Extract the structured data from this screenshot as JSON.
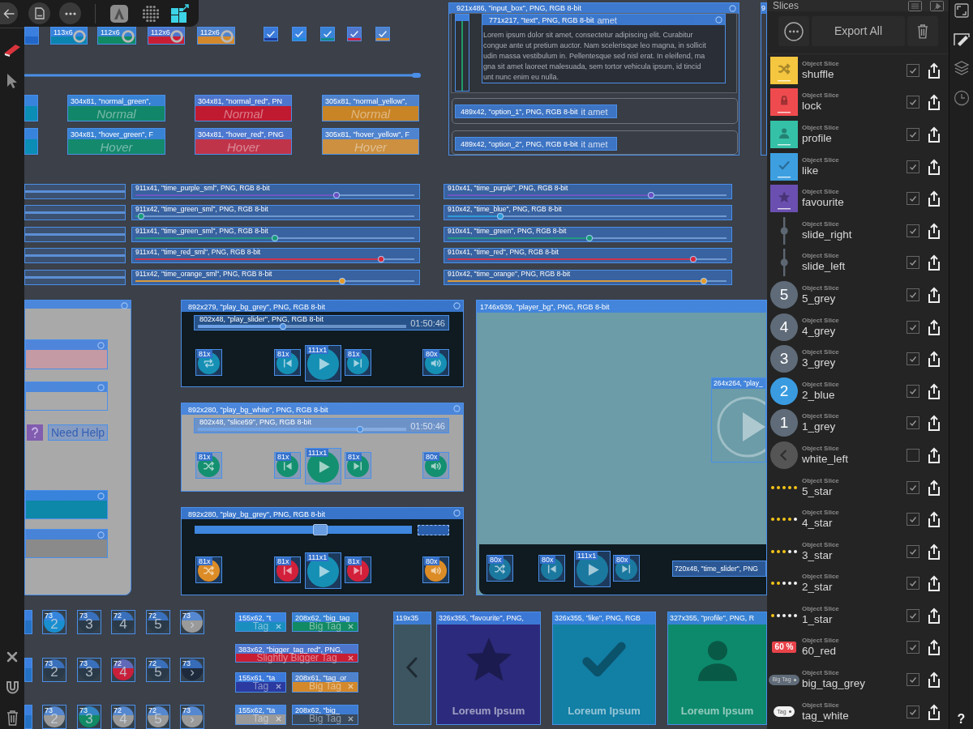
{
  "toolbar": {
    "personas": [
      {
        "kind": "designer",
        "selected": false
      },
      {
        "kind": "pixel",
        "selected": false
      },
      {
        "kind": "export",
        "selected": true
      }
    ]
  },
  "canvas": {
    "toggles": [
      {
        "color": "#2266c8"
      },
      {
        "label": "113x6",
        "color": "#0c84b0"
      },
      {
        "label": "112x6",
        "color": "#118a64"
      },
      {
        "label": "112x6",
        "color": "#c81e34"
      },
      {
        "label": "112x6",
        "color": "#d3892b"
      }
    ],
    "checkboxes": [
      {
        "color": "#1c3b9c",
        "checked": true
      },
      {
        "color": "#1e8ad8",
        "checked": true
      },
      {
        "color": "#128a8a",
        "checked": true
      },
      {
        "color": "#d3203a",
        "checked": true
      },
      {
        "color": "#d3892b",
        "checked": true
      }
    ],
    "button_rows": [
      {
        "items": [
          {
            "color": "#0b8db5"
          },
          {
            "label": "304x81, \"normal_green\",",
            "text": "Normal",
            "color": "#128669"
          },
          {
            "label": "304x81, \"normal_red\", PN",
            "text": "Normal",
            "color": "#c01a31"
          },
          {
            "label": "305x81, \"normal_yellow\",",
            "text": "Normal",
            "color": "#c98426"
          }
        ]
      },
      {
        "items": [
          {
            "color": "#0b8db5"
          },
          {
            "label": "304x81, \"hover_green\", F",
            "text": "Hover",
            "color": "#14896c"
          },
          {
            "label": "304x81, \"hover_red\", PNG",
            "text": "Hover",
            "color": "#c0344a"
          },
          {
            "label": "305x81, \"hover_yellow\", F",
            "text": "Hover",
            "color": "#cc9040"
          }
        ]
      }
    ],
    "slider_columns": [
      {
        "items": [
          {
            "label": "911x41, \"time_purple_sml\", PNG, RGB 8-bit",
            "level": 0.72,
            "color": "#6b4fc0"
          },
          {
            "label": "911x42, \"time_green_sml\", PNG, RGB 8-bit",
            "level": 0.02,
            "color": "#1a9a78"
          },
          {
            "label": "911x41, \"time_green_sml\", PNG, RGB 8-bit",
            "level": 0.5,
            "color": "#1a9a78"
          },
          {
            "label": "911x41, \"time_red_sml\", PNG, RGB 8-bit",
            "level": 0.88,
            "color": "#d8283c"
          },
          {
            "label": "911x42, \"time_orange_sml\", PNG, RGB 8-bit",
            "level": 0.74,
            "color": "#e49a2a"
          }
        ]
      },
      {
        "items": [
          {
            "label": "910x41, \"time_purple\", PNG, RGB 8-bit",
            "level": 0.73,
            "color": "#6b4fc0"
          },
          {
            "label": "910x42, \"time_blue\", PNG, RGB 8-bit",
            "level": 0.19,
            "color": "#2a9bd8"
          },
          {
            "label": "910x41, \"time_green\", PNG, RGB 8-bit",
            "level": 0.51,
            "color": "#1a9a78"
          },
          {
            "label": "910x41, \"time_red\", PNG, RGB 8-bit",
            "level": 0.88,
            "color": "#d8283c"
          },
          {
            "label": "910x42, \"time_orange\", PNG, RGB 8-bit",
            "level": 0.92,
            "color": "#e49a2a"
          }
        ]
      }
    ],
    "input_box": {
      "label": "921x486, \"input_box\", PNG, RGB 8-bit",
      "text_slice": {
        "label": "771x217, \"text\", PNG, RGB 8-bit",
        "faded_text": "amet",
        "lines": [
          "Lorem ipsum dolor sit amet, consectetur adipiscing elit. Curabitur",
          "congue ante ut pretium auctor. Nam scelerisque leo magna, in sollicit",
          "udin massa vestibulum in. Pellentesque sed nisl erat. In eleifend, ma",
          "gna sit amet laoreet malesuada, sem tortor vehicula ipsum, id tincid",
          "unt nunc enim eu nulla."
        ]
      },
      "options": [
        {
          "label": "489x42, \"option_1\", PNG, RGB 8-bit",
          "faded_text": "it amet"
        },
        {
          "label": "489x42, \"option_2\", PNG, RGB 8-bit",
          "faded_text": "it amet"
        }
      ]
    },
    "edge_slice": {
      "label": "9"
    },
    "form_panel": {
      "rows": [
        {
          "kind": "bar",
          "color": "#c49aa4"
        },
        {
          "kind": "bar",
          "color": "#aaaaaa"
        },
        {
          "kind": "help",
          "text": "Need Help"
        },
        {
          "kind": "bar",
          "color": "#0d88a8"
        },
        {
          "kind": "bar",
          "color": "#8a8a8a"
        }
      ]
    },
    "players": [
      {
        "label": "892x279, \"play_bg_grey\", PNG, RGB 8-bit",
        "kind": "dark",
        "slider": {
          "kind": "slice",
          "label": "802x48, \"play_slider\", PNG, RGB 8-bit",
          "time": "01:50:46",
          "level": 0.41
        },
        "buttons": [
          {
            "label": "81x",
            "kind": "repeat",
            "color": "#1590b4"
          },
          {
            "label": "81x",
            "kind": "previous",
            "color": "#1590b4"
          },
          {
            "label": "111x1",
            "kind": "play",
            "color": "#1590b4"
          },
          {
            "label": "81x",
            "kind": "next",
            "color": "#1590b4"
          },
          {
            "label": "80x",
            "kind": "volume",
            "color": "#1590b4"
          }
        ]
      },
      {
        "label": "892x280, \"play_bg_white\", PNG, RGB 8-bit",
        "kind": "light",
        "slider": {
          "kind": "slice",
          "label": "802x48, \"slice59\", PNG, RGB 8-bit",
          "time": "01:50:46",
          "level": 0.78
        },
        "buttons": [
          {
            "label": "81x",
            "kind": "shuffle",
            "color": "#139070"
          },
          {
            "label": "81x",
            "kind": "previous",
            "color": "#139070"
          },
          {
            "label": "111x1",
            "kind": "play",
            "color": "#139070"
          },
          {
            "label": "81x",
            "kind": "next",
            "color": "#139070"
          },
          {
            "label": "80x",
            "kind": "volume",
            "color": "#139070"
          }
        ]
      },
      {
        "label": "892x280, \"play_bg_grey\", PNG, RGB 8-bit",
        "kind": "dark",
        "slider": {
          "kind": "bar",
          "level": 0.58
        },
        "buttons": [
          {
            "label": "81x",
            "kind": "shuffle",
            "color": "#dc8c26"
          },
          {
            "label": "81x",
            "kind": "previous",
            "color": "#d3203a"
          },
          {
            "label": "111x1",
            "kind": "play",
            "color": "#1590b4"
          },
          {
            "label": "81x",
            "kind": "next",
            "color": "#d3203a"
          },
          {
            "label": "80x",
            "kind": "volume",
            "color": "#dc8c26"
          }
        ]
      }
    ],
    "player_bg": {
      "label": "1746x939, \"player_bg\", PNG, RGB 8-bit",
      "play_slice": {
        "label": "264x264, \"play_"
      },
      "buttons": [
        {
          "label": "80x",
          "kind": "shuffle",
          "color": "#1b79a0"
        },
        {
          "label": "80x",
          "kind": "previous",
          "color": "#1b79a0"
        },
        {
          "label": "111x1",
          "kind": "play",
          "color": "#1b79a0"
        },
        {
          "label": "80x",
          "kind": "next",
          "color": "#1b79a0"
        }
      ],
      "time_slider": {
        "label": "720x48, \"time_slider\", PNG"
      }
    },
    "number_rows": [
      {
        "items": [
          {
            "color": "#2471c4"
          },
          {
            "label": "73",
            "text": "2",
            "color": "#1a8fcf"
          },
          {
            "label": "73",
            "text": "3",
            "color": "#2b3a48"
          },
          {
            "label": "72",
            "text": "4",
            "color": "#2b3a48"
          },
          {
            "label": "72",
            "text": "5",
            "color": "#2b3a48"
          },
          {
            "label": "73",
            "text": "›",
            "color": "#9a9a9a"
          }
        ]
      },
      {
        "items": [
          {
            "color": "#2471c4"
          },
          {
            "label": "73",
            "text": "2",
            "color": "#2b3a48"
          },
          {
            "label": "73",
            "text": "3",
            "color": "#2b3a48"
          },
          {
            "label": "72",
            "text": "4",
            "color": "#c8203a"
          },
          {
            "label": "72",
            "text": "5",
            "color": "#2b3a48"
          },
          {
            "label": "73",
            "text": "›",
            "color": "#1e2a3c"
          }
        ]
      },
      {
        "items": [
          {
            "color": "#2471c4"
          },
          {
            "label": "73",
            "text": "2",
            "color": "#9a9a9a"
          },
          {
            "label": "73",
            "text": "3",
            "color": "#128a64"
          },
          {
            "label": "72",
            "text": "4",
            "color": "#9a9a9a"
          },
          {
            "label": "72",
            "text": "5",
            "color": "#9a9a9a"
          },
          {
            "label": "73",
            "text": "›",
            "color": "#9a9a9a"
          }
        ]
      }
    ],
    "tag_rows": [
      {
        "items": [
          {
            "kind": "small",
            "label": "155x62, \"t",
            "text": "Tag",
            "color": "#1a8fbf"
          },
          {
            "kind": "big",
            "label": "208x62, \"big_tag",
            "text": "Big Tag",
            "color": "#128a64"
          }
        ]
      },
      {
        "items": [
          {
            "kind": "wide",
            "label": "383x62, \"bigger_tag_red\", PNG,",
            "text": "Slightly Bigger Tag",
            "color": "#c81e34"
          }
        ]
      },
      {
        "items": [
          {
            "kind": "small",
            "label": "155x61, \"ta",
            "text": "Tag",
            "color": "#2a3aa0"
          },
          {
            "kind": "big",
            "label": "208x61, \"tag_or",
            "text": "Big Tag",
            "color": "#d3892b"
          }
        ]
      },
      {
        "items": [
          {
            "kind": "small",
            "label": "155x62, \"ta",
            "text": "Tag",
            "color": "#9a9a9a"
          },
          {
            "kind": "big",
            "label": "208x62, \"big_",
            "text": "Big Tag",
            "color": "#3a4a5c"
          }
        ]
      }
    ],
    "cards": [
      {
        "kind": "arrow",
        "label": "119x35",
        "color": "#3c5560"
      },
      {
        "kind": "star",
        "label": "326x355, \"favourite\", PNG,",
        "text": "Loreum Ipsum",
        "color": "#2c2a7c"
      },
      {
        "kind": "check",
        "label": "326x355, \"like\", PNG, RGB",
        "text": "Loreum Ipsum",
        "color": "#127fa5"
      },
      {
        "kind": "person",
        "label": "327x355, \"profile\", PNG, R",
        "text": "Loreum Ipsum",
        "color": "#0d8a6c"
      }
    ]
  },
  "slices_panel": {
    "title": "Slices",
    "export_label": "Export All",
    "items": [
      {
        "subtitle": "Object Slice",
        "name": "shuffle",
        "checked": true,
        "thumb": {
          "kind": "shuffle",
          "color": "#f5c63f"
        }
      },
      {
        "subtitle": "Object Slice",
        "name": "lock",
        "checked": true,
        "thumb": {
          "kind": "lock",
          "color": "#ef4b4f"
        }
      },
      {
        "subtitle": "Object Slice",
        "name": "profile",
        "checked": true,
        "thumb": {
          "kind": "person",
          "color": "#35c0a8"
        }
      },
      {
        "subtitle": "Object Slice",
        "name": "like",
        "checked": true,
        "thumb": {
          "kind": "check",
          "color": "#3d9fe0"
        }
      },
      {
        "subtitle": "Object Slice",
        "name": "favourite",
        "checked": true,
        "thumb": {
          "kind": "star",
          "color": "#6a4fb0"
        }
      },
      {
        "subtitle": "Object Slice",
        "name": "slide_right",
        "checked": true,
        "thumb": {
          "kind": "slider"
        }
      },
      {
        "subtitle": "Object Slice",
        "name": "slide_left",
        "checked": true,
        "thumb": {
          "kind": "slider"
        }
      },
      {
        "subtitle": "Object Slice",
        "name": "5_grey",
        "checked": true,
        "thumb": {
          "kind": "number",
          "text": "5",
          "color": "#5f6b78"
        }
      },
      {
        "subtitle": "Object Slice",
        "name": "4_grey",
        "checked": true,
        "thumb": {
          "kind": "number",
          "text": "4",
          "color": "#5f6b78"
        }
      },
      {
        "subtitle": "Object Slice",
        "name": "3_grey",
        "checked": true,
        "thumb": {
          "kind": "number",
          "text": "3",
          "color": "#5f6b78"
        }
      },
      {
        "subtitle": "Object Slice",
        "name": "2_blue",
        "checked": true,
        "thumb": {
          "kind": "number",
          "text": "2",
          "color": "#3a9be0"
        }
      },
      {
        "subtitle": "Object Slice",
        "name": "1_grey",
        "checked": true,
        "thumb": {
          "kind": "number",
          "text": "1",
          "color": "#5f6b78"
        }
      },
      {
        "subtitle": "Object Slice",
        "name": "white_left",
        "checked": false,
        "thumb": {
          "kind": "arrow"
        }
      },
      {
        "subtitle": "Object Slice",
        "name": "5_star",
        "checked": true,
        "thumb": {
          "kind": "stars",
          "stars": 5
        }
      },
      {
        "subtitle": "Object Slice",
        "name": "4_star",
        "checked": true,
        "thumb": {
          "kind": "stars",
          "stars": 4
        }
      },
      {
        "subtitle": "Object Slice",
        "name": "3_star",
        "checked": true,
        "thumb": {
          "kind": "stars",
          "stars": 3
        }
      },
      {
        "subtitle": "Object Slice",
        "name": "2_star",
        "checked": true,
        "thumb": {
          "kind": "stars",
          "stars": 2
        }
      },
      {
        "subtitle": "Object Slice",
        "name": "1_star",
        "checked": true,
        "thumb": {
          "kind": "stars",
          "stars": 1
        }
      },
      {
        "subtitle": "Object Slice",
        "name": "60_red",
        "checked": true,
        "thumb": {
          "kind": "badge",
          "text": "60 %"
        }
      },
      {
        "subtitle": "Object Slice",
        "name": "big_tag_grey",
        "checked": true,
        "thumb": {
          "kind": "pill",
          "text": "Big Tag",
          "color": "#5f6b78"
        }
      },
      {
        "subtitle": "Object Slice",
        "name": "tag_white",
        "checked": true,
        "thumb": {
          "kind": "pill",
          "text": "Tag",
          "color": "#f2f2f2"
        }
      }
    ]
  },
  "right_strip": {
    "help": "?"
  }
}
